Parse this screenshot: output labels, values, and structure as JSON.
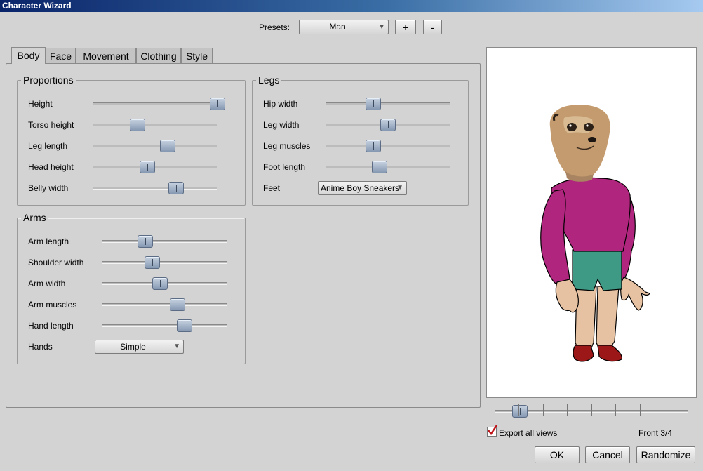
{
  "window": {
    "title": "Character Wizard"
  },
  "presets": {
    "label": "Presets:",
    "value": "Man",
    "add_label": "+",
    "remove_label": "-"
  },
  "tabs": [
    {
      "label": "Body",
      "active": true
    },
    {
      "label": "Face",
      "active": false
    },
    {
      "label": "Movement",
      "active": false
    },
    {
      "label": "Clothing",
      "active": false
    },
    {
      "label": "Style",
      "active": false
    }
  ],
  "proportions": {
    "title": "Proportions",
    "sliders": [
      {
        "label": "Height",
        "value": 1.0
      },
      {
        "label": "Torso height",
        "value": 0.36
      },
      {
        "label": "Leg length",
        "value": 0.6
      },
      {
        "label": "Head height",
        "value": 0.44
      },
      {
        "label": "Belly width",
        "value": 0.67
      }
    ]
  },
  "legs": {
    "title": "Legs",
    "sliders": [
      {
        "label": "Hip width",
        "value": 0.38
      },
      {
        "label": "Leg width",
        "value": 0.5
      },
      {
        "label": "Leg muscles",
        "value": 0.38
      },
      {
        "label": "Foot length",
        "value": 0.43
      }
    ],
    "feet_label": "Feet",
    "feet_value": "Anime Boy Sneakers"
  },
  "arms": {
    "title": "Arms",
    "sliders": [
      {
        "label": "Arm length",
        "value": 0.34
      },
      {
        "label": "Shoulder width",
        "value": 0.4
      },
      {
        "label": "Arm width",
        "value": 0.46
      },
      {
        "label": "Arm muscles",
        "value": 0.6
      },
      {
        "label": "Hand length",
        "value": 0.66
      }
    ],
    "hands_label": "Hands",
    "hands_value": "Simple"
  },
  "view": {
    "slider_value": 0.13,
    "export_label": "Export all views",
    "export_checked": true,
    "view_label": "Front 3/4"
  },
  "buttons": {
    "ok": "OK",
    "cancel": "Cancel",
    "randomize": "Randomize"
  },
  "colors": {
    "shirt": "#b0257d",
    "shorts": "#3f9a85",
    "skin": "#e7c2a2",
    "shoes": "#9c1818"
  }
}
